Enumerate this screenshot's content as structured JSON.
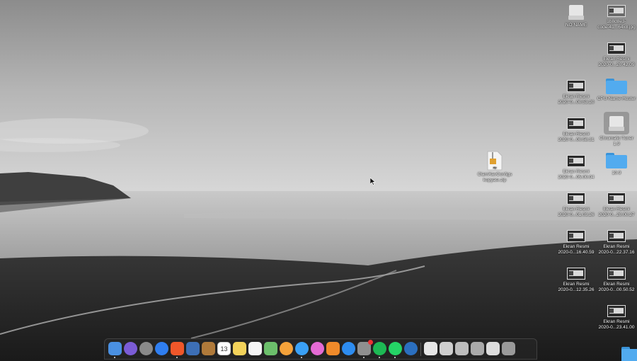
{
  "desktop": {
    "right_column": [
      {
        "name": "NO NAME",
        "kind": "drive"
      },
      {
        "name": "Ekran Resmi\n2020-0...20.42.09",
        "kind": "screenshot"
      },
      {
        "name": "Ekran Resmi\n2020-0...00.53.20",
        "kind": "screenshot"
      },
      {
        "name": "Ekran Resmi\n2020-0...00.58.31",
        "kind": "screenshot"
      },
      {
        "name": "Ekran Resmi\n2020-0...05.00.04",
        "kind": "screenshot"
      },
      {
        "name": "Ekran Resmi\n2020-0...01.03.26",
        "kind": "screenshot"
      },
      {
        "name": "Ekran Resmi\n2020-0...16.40.59",
        "kind": "screenshot"
      },
      {
        "name": "Ekran Resmi\n2020-0...12.35.26",
        "kind": "screenshot"
      }
    ],
    "far_column": [
      {
        "name": "1b8d8e3-\ncode-41...64x8.jpg",
        "kind": "image"
      },
      {
        "name": "CPU-Name-Hoster",
        "kind": "folder"
      },
      {
        "name": "Chromatic Tuner\n1.9",
        "kind": "app"
      },
      {
        "name": "10.9",
        "kind": "folder"
      },
      {
        "name": "Ekran Resmi\n2020-0...20.00.27",
        "kind": "screenshot"
      },
      {
        "name": "Ekran Resmi\n2020-0...22.37.16",
        "kind": "screenshot"
      },
      {
        "name": "Ekran Resmi\n2020-0...00.50.52",
        "kind": "screenshot"
      },
      {
        "name": "Ekran Resmi\n2020-0...23.41.00",
        "kind": "screenshot"
      }
    ],
    "middle_file": {
      "name": "ClamXavConfigs\nkopyası.zip",
      "kind": "zip"
    }
  },
  "dock": {
    "items": [
      {
        "icon": "finder-icon",
        "color": "#4a90e2",
        "running": true
      },
      {
        "icon": "siri-icon",
        "color": "#7b5cd6",
        "running": false
      },
      {
        "icon": "launchpad-icon",
        "color": "#8a8a8a",
        "running": false
      },
      {
        "icon": "safari-icon",
        "color": "#2f7ef0",
        "running": false
      },
      {
        "icon": "brave-browser-icon",
        "color": "#f0572a",
        "running": true
      },
      {
        "icon": "preview-icon",
        "color": "#3d6fb6",
        "running": false
      },
      {
        "icon": "notefile-icon",
        "color": "#b07a3a",
        "running": false
      },
      {
        "icon": "calendar-icon",
        "color": "#ffffff",
        "running": false,
        "label": "13"
      },
      {
        "icon": "notes-icon",
        "color": "#f3d25a",
        "running": false
      },
      {
        "icon": "reminders-icon",
        "color": "#f5f5f5",
        "running": false
      },
      {
        "icon": "maps-icon",
        "color": "#6cbf6b",
        "running": false
      },
      {
        "icon": "photos-icon",
        "color": "#f4a23a",
        "running": false
      },
      {
        "icon": "messages-icon",
        "color": "#3aa0f5",
        "running": true
      },
      {
        "icon": "itunes-icon",
        "color": "#e46ad4",
        "running": false
      },
      {
        "icon": "books-icon",
        "color": "#f08a2a",
        "running": false
      },
      {
        "icon": "app-store-icon",
        "color": "#2d8cf0",
        "running": false
      },
      {
        "icon": "system-preferences-icon",
        "color": "#8f8f8f",
        "running": true,
        "badge": true
      },
      {
        "icon": "spotify-icon",
        "color": "#1db954",
        "running": true
      },
      {
        "icon": "whatsapp-icon",
        "color": "#25d366",
        "running": true
      },
      {
        "icon": "edge-icon",
        "color": "#2b6fbf",
        "running": false
      },
      {
        "icon": "document-icon",
        "color": "#e6e6e6",
        "running": false
      },
      {
        "icon": "screenshot-stack-icon",
        "color": "#cfcfcf",
        "running": false
      },
      {
        "icon": "stack-icon",
        "color": "#bdbdbd",
        "running": false
      },
      {
        "icon": "window-stack-icon",
        "color": "#a9a9a9",
        "running": false
      },
      {
        "icon": "downloads-stack-icon",
        "color": "#dcdcdc",
        "running": false
      },
      {
        "icon": "trash-icon",
        "color": "#9a9a9a",
        "running": false
      }
    ]
  }
}
